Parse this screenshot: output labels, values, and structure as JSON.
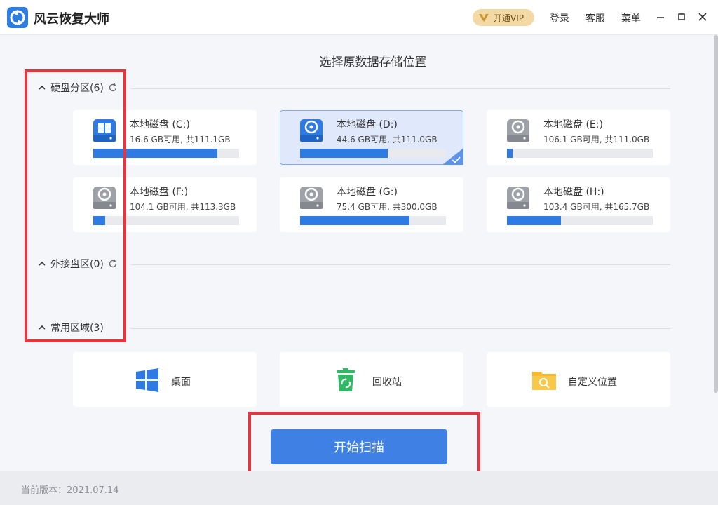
{
  "app": {
    "title": "风云恢复大师",
    "vip_label": "开通VIP",
    "login_label": "登录",
    "service_label": "客服",
    "menu_label": "菜单"
  },
  "main": {
    "heading": "选择原数据存储位置"
  },
  "sections": {
    "hard_disk": {
      "label": "硬盘分区(6)"
    },
    "external": {
      "label": "外接盘区(0)"
    },
    "common": {
      "label": "常用区域(3)"
    }
  },
  "drives": [
    {
      "name": "本地磁盘 (C:)",
      "info": "16.6 GB可用, 共111.1GB",
      "used_fraction": 0.85,
      "selected": false
    },
    {
      "name": "本地磁盘 (D:)",
      "info": "44.6 GB可用, 共111.0GB",
      "used_fraction": 0.6,
      "selected": true
    },
    {
      "name": "本地磁盘 (E:)",
      "info": "106.1 GB可用, 共111.0GB",
      "used_fraction": 0.04,
      "selected": false
    },
    {
      "name": "本地磁盘 (F:)",
      "info": "104.1 GB可用, 共113.3GB",
      "used_fraction": 0.08,
      "selected": false
    },
    {
      "name": "本地磁盘 (G:)",
      "info": "75.4 GB可用, 共300.0GB",
      "used_fraction": 0.75,
      "selected": false
    },
    {
      "name": "本地磁盘 (H:)",
      "info": "103.4 GB可用, 共165.7GB",
      "used_fraction": 0.37,
      "selected": false
    }
  ],
  "common": [
    {
      "label": "桌面",
      "icon": "windows-icon"
    },
    {
      "label": "回收站",
      "icon": "recycle-bin-icon"
    },
    {
      "label": "自定义位置",
      "icon": "folder-search-icon"
    }
  ],
  "start_button": {
    "label": "开始扫描"
  },
  "footer": {
    "version": "当前版本：2021.07.14"
  },
  "colors": {
    "accent": "#3f80e5",
    "bar_fill": "#2f7be3",
    "highlight": "#e8343c",
    "vip": "#f3d9a5"
  }
}
